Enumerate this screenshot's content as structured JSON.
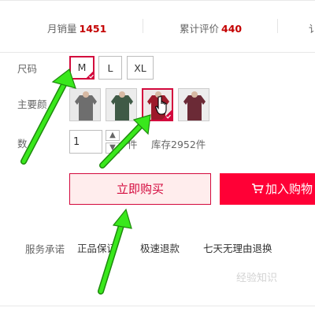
{
  "stats": {
    "monthly_sales_label": "月销量",
    "monthly_sales_value": "1451",
    "total_reviews_label": "累计评价",
    "total_reviews_value": "440",
    "third_label_partial": "讠"
  },
  "size": {
    "label": "尺码",
    "options": [
      "M",
      "L",
      "XL"
    ],
    "selected": "M"
  },
  "color": {
    "label_partial": "主要颜",
    "swatch_count": 4,
    "selected_index": 2
  },
  "quantity": {
    "label_partial": "数",
    "value": "1",
    "unit_partial": "件",
    "stock": "库存2952件"
  },
  "actions": {
    "buy_now": "立即购买",
    "add_to_cart": "加入购物"
  },
  "service": {
    "label": "服务承诺",
    "items": [
      "正品保证",
      "极速退款",
      "七天无理由退换"
    ]
  },
  "watermark": "经验知识",
  "colors": {
    "accent": "#d3093d",
    "cart_button": "#ff0036",
    "buy_bg": "#ffeded",
    "arrow": "#39e81c"
  }
}
